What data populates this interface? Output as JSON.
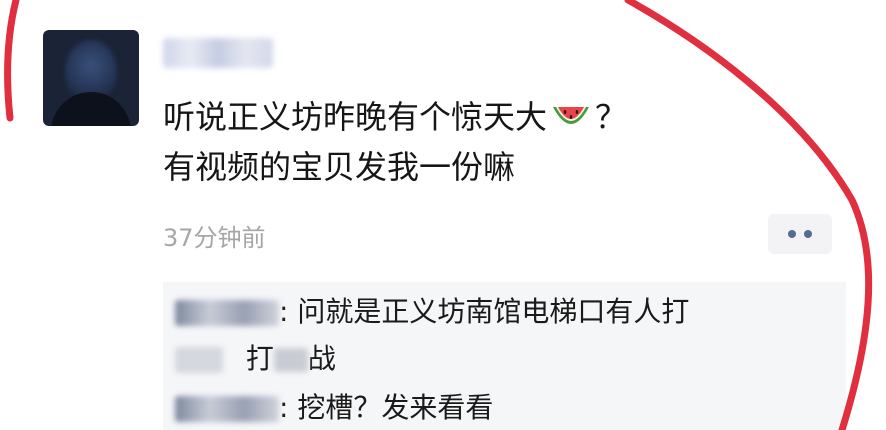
{
  "post": {
    "text_line1_before": "听说正义坊昨晚有个惊天大",
    "text_line1_emoji": "watermelon",
    "text_line1_after": "？",
    "text_line2": "有视频的宝贝发我一份嘛",
    "timestamp": "37分钟前",
    "more_icon": "two-dots-icon"
  },
  "comments": [
    {
      "text": ": 问就是正义坊南馆电梯口有人打",
      "continuation": "打",
      "continuation_end": "战"
    },
    {
      "text": ": 挖槽？发来看看"
    }
  ],
  "colors": {
    "annotation": "#e0303f",
    "name_link": "#576b95",
    "timestamp": "#a6a6a6",
    "comment_bg": "#f5f6f8"
  }
}
